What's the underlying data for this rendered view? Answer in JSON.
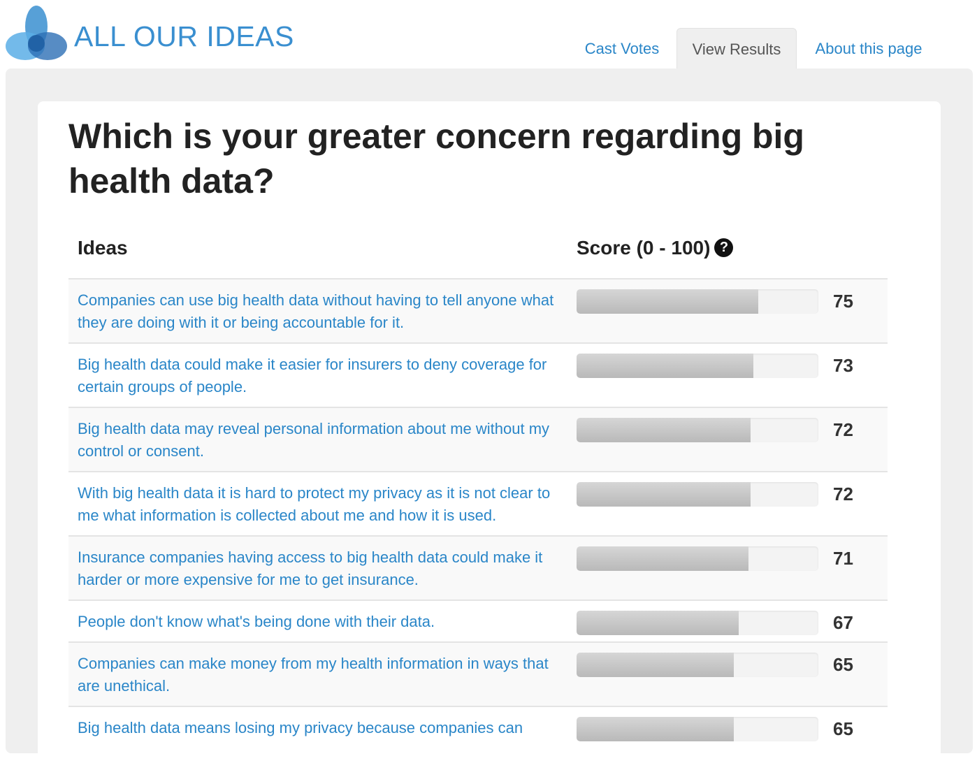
{
  "brand": {
    "name": "ALL OUR IDEAS",
    "logo_colors": [
      "#3a8fd0",
      "#5aaee6",
      "#2d6fb5"
    ]
  },
  "nav": {
    "tabs": [
      {
        "label": "Cast Votes",
        "active": false
      },
      {
        "label": "View Results",
        "active": true
      },
      {
        "label": "About this page",
        "active": false
      }
    ]
  },
  "question": "Which is your greater concern regarding big health data?",
  "table": {
    "ideas_header": "Ideas",
    "score_header": "Score (0 - 100)",
    "help_icon": "question-circle-icon",
    "rows": [
      {
        "idea": "Companies can use big health data without having to tell anyone what they are doing with it or being accountable for it.",
        "score": "75"
      },
      {
        "idea": "Big health data could make it easier for insurers to deny coverage for certain groups of people.",
        "score": "73"
      },
      {
        "idea": "Big health data may reveal personal information about me without my control or consent.",
        "score": "72"
      },
      {
        "idea": "With big health data it is hard to protect my privacy as it is not clear to me what information is collected about me and how it is used.",
        "score": "72"
      },
      {
        "idea": "Insurance companies having access to big health data could make it harder or more expensive for me to get insurance.",
        "score": "71"
      },
      {
        "idea": "People don't know what's being done with their data.",
        "score": "67"
      },
      {
        "idea": "Companies can make money from my health information in ways that are unethical.",
        "score": "65"
      },
      {
        "idea": "Big health data means losing my privacy because companies can",
        "score": "65"
      }
    ]
  },
  "colors": {
    "link": "#2a86c8",
    "brand": "#3a8fd0",
    "panel": "#efefef",
    "bar": "#c4c4c4"
  }
}
